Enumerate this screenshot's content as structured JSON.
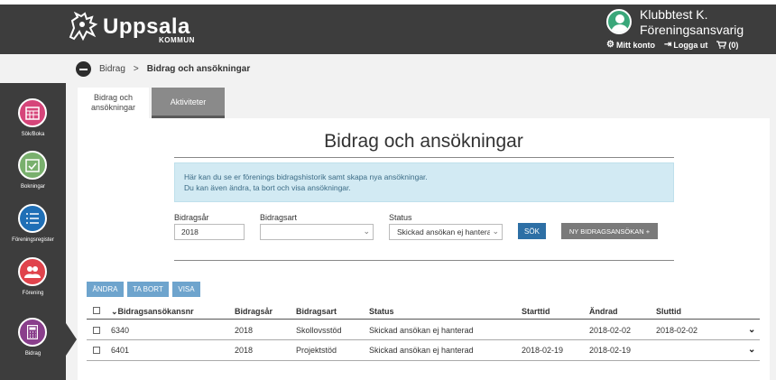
{
  "header": {
    "logo_text": "Uppsala",
    "logo_subtext": "KOMMUN",
    "user_name": "Klubbtest K.",
    "user_role": "Föreningsansvarig",
    "links": [
      {
        "label": "Mitt konto",
        "icon": "gear-icon"
      },
      {
        "label": "Logga ut",
        "icon": "logout-icon"
      },
      {
        "label": "(0)",
        "icon": "cart-icon"
      }
    ]
  },
  "sidebar": {
    "items": [
      {
        "label": "Sök/Boka",
        "color": "#d6457a",
        "icon": "calendar-icon"
      },
      {
        "label": "Bokningar",
        "color": "#79b06d",
        "icon": "calendar-check-icon"
      },
      {
        "label": "Föreningsregister",
        "color": "#1f6fb6",
        "icon": "list-icon"
      },
      {
        "label": "Förening",
        "color": "#e0434c",
        "icon": "people-icon"
      },
      {
        "label": "Bidrag",
        "color": "#8a3f8c",
        "icon": "calculator-icon",
        "active": true
      }
    ]
  },
  "breadcrumb": {
    "parent": "Bidrag",
    "separator": ">",
    "current": "Bidrag och ansökningar"
  },
  "tabs": [
    {
      "label": "Bidrag och ansökningar",
      "active": true
    },
    {
      "label": "Aktiviteter",
      "active": false
    }
  ],
  "main": {
    "title": "Bidrag och ansökningar",
    "info_line1": "Här kan du se er förenings bidragshistorik samt skapa nya ansökningar.",
    "info_line2": "Du kan även ändra, ta bort och visa ansökningar."
  },
  "filters": {
    "year_label": "Bidragsår",
    "year_value": "2018",
    "type_label": "Bidragsart",
    "type_value": "",
    "status_label": "Status",
    "status_value": "Skickad ansökan ej hanterad",
    "search_button": "SÖK",
    "new_button": "NY BIDRAGSANSÖKAN +"
  },
  "actions": {
    "edit": "ÄNDRA",
    "delete": "TA BORT",
    "view": "VISA"
  },
  "table": {
    "sort_icon": "chevron-down-icon",
    "columns": [
      "Bidragsansökansnr",
      "Bidragsår",
      "Bidragsart",
      "Status",
      "Starttid",
      "Ändrad",
      "Sluttid"
    ],
    "rows": [
      {
        "nr": "6340",
        "year": "2018",
        "type": "Skollovsstöd",
        "status": "Skickad ansökan ej hanterad",
        "start": "",
        "changed": "2018-02-02",
        "end": "2018-02-02"
      },
      {
        "nr": "6401",
        "year": "2018",
        "type": "Projektstöd",
        "status": "Skickad ansökan ej hanterad",
        "start": "2018-02-19",
        "changed": "2018-02-19",
        "end": ""
      }
    ]
  },
  "colors": {
    "accent": "#2d6fa5",
    "info_bg": "#d2eaf3",
    "header_bg": "#3d3d3d",
    "action_button": "#6ea4cd"
  }
}
